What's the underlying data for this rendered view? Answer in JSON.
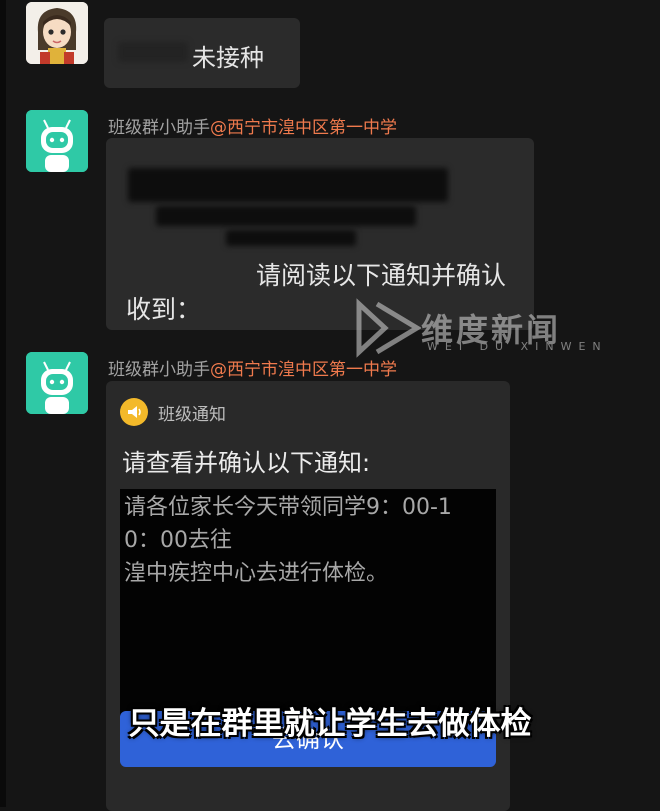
{
  "messages": [
    {
      "text": "未接种"
    },
    {
      "sender_name": "班级群小助手",
      "sender_group": "@西宁市湟中区第一中学",
      "line1": "请阅读以下通知并确认",
      "line2": "收到："
    },
    {
      "sender_name": "班级群小助手",
      "sender_group": "@西宁市湟中区第一中学"
    }
  ],
  "card": {
    "tag": "班级通知",
    "title": "请查看并确认以下通知:",
    "notice_lines": [
      "请各位家长今天带领同学9：00-1",
      "0：00去往",
      "湟中疾控中心去进行体检。"
    ],
    "button": "去确认"
  },
  "watermark": {
    "main": "维度新闻",
    "sub": "WEI DU XINWEN"
  },
  "subtitle": "只是在群里就让学生去做体检",
  "colors": {
    "background": "#151515",
    "bubble": "#2b2b2b",
    "sender_at": "#f07a4d",
    "bot_avatar": "#2fc9a6",
    "button": "#2f62d8",
    "tag_icon": "#f3b92a"
  },
  "icons": [
    "girl-avatar",
    "robot-avatar",
    "megaphone-icon"
  ]
}
